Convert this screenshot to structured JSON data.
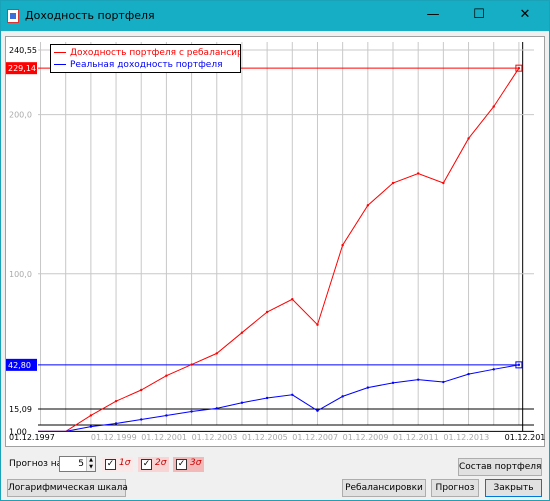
{
  "window": {
    "title": "Доходность портфеля",
    "minimize": "—",
    "maximize": "☐",
    "close": "✕"
  },
  "chart_data": {
    "type": "line",
    "title": "",
    "xlabel": "",
    "ylabel": "",
    "ylim": [
      0,
      240.55
    ],
    "y_ticks": [
      "240,55",
      "200,0",
      "100,0",
      "15,09",
      "1,00"
    ],
    "y_tick_values": [
      240.55,
      200.0,
      100.0,
      15.09,
      1.0
    ],
    "x_ticks": [
      "01.12.1997",
      "01.12.1999",
      "01.12.2001",
      "01.12.2003",
      "01.12.2005",
      "01.12.2007",
      "01.12.2009",
      "01.12.2011",
      "01.12.2013",
      "01.12.2016"
    ],
    "x": [
      1996.8,
      1997.9,
      1998.9,
      1999.9,
      2000.9,
      2001.9,
      2002.9,
      2003.9,
      2004.9,
      2005.9,
      2006.9,
      2007.9,
      2008.9,
      2009.9,
      2010.9,
      2011.9,
      2012.9,
      2013.9,
      2014.9,
      2015.9
    ],
    "series": [
      {
        "name": "Доходность портфеля с ребалансировкой",
        "color": "#ff0000",
        "values": [
          1.0,
          1.0,
          11.0,
          20.0,
          27.0,
          36.0,
          43.0,
          50.0,
          63.0,
          76.0,
          84.0,
          68.0,
          118.0,
          143.0,
          157.0,
          163.0,
          157.0,
          185.0,
          205.0,
          229.14
        ]
      },
      {
        "name": "Реальная доходность портфеля",
        "color": "#0000ff",
        "values": [
          1.0,
          1.0,
          4.0,
          6.0,
          8.5,
          11.0,
          13.5,
          15.5,
          19.0,
          22.0,
          24.0,
          14.0,
          23.0,
          28.5,
          31.5,
          33.5,
          32.0,
          37.0,
          40.0,
          42.8
        ]
      }
    ],
    "markers": [
      {
        "label": "229,14",
        "value": 229.14,
        "color": "#ff0000"
      },
      {
        "label": "42,80",
        "value": 42.8,
        "color": "#0000ff"
      }
    ],
    "grid": true,
    "legend": "top-left"
  },
  "controls": {
    "forecast_label": "Прогноз на:",
    "forecast_years": "5",
    "sigma1": "1σ",
    "sigma2": "2σ",
    "sigma3": "3σ",
    "log_scale_button": "Логарифмическая шкала",
    "composition_button": "Состав портфеля",
    "rebalance_button": "Ребалансировки",
    "forecast_button": "Прогноз",
    "close_button": "Закрыть"
  }
}
